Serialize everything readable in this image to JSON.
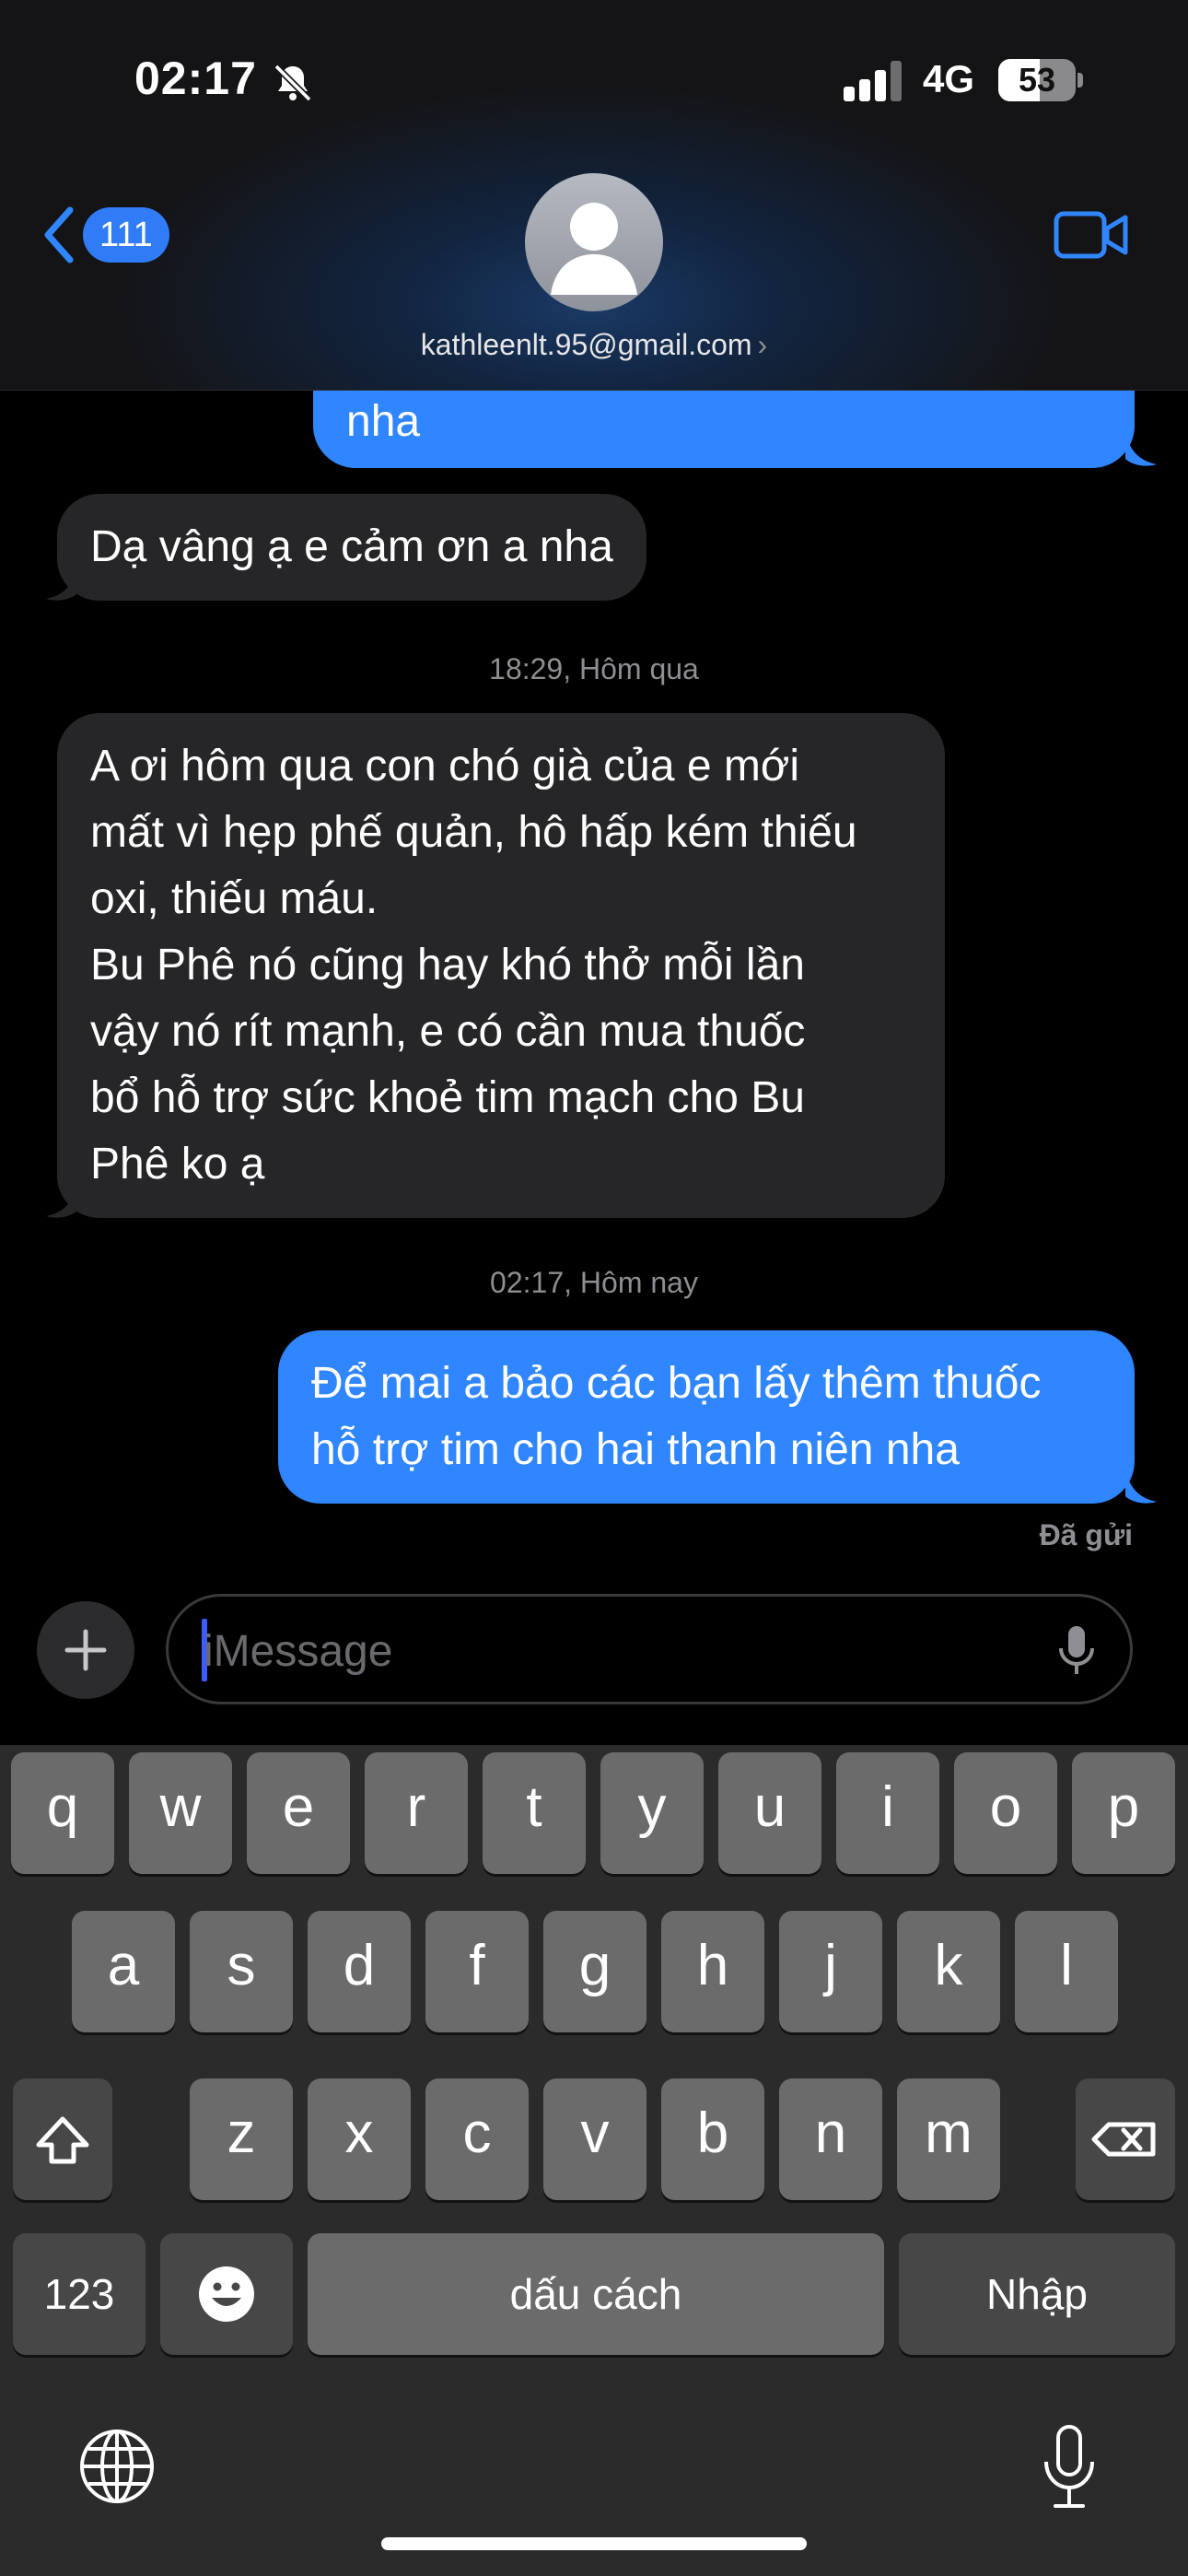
{
  "status": {
    "time": "02:17",
    "network": "4G",
    "battery": "53",
    "battery_level": 0.53
  },
  "header": {
    "back_count": "111",
    "contact": "kathleenlt.95@gmail.com",
    "contact_chevron": "›"
  },
  "messages": [
    {
      "type": "sent",
      "text": "nha"
    },
    {
      "type": "received",
      "text": "Dạ vâng ạ e cảm ơn a nha"
    },
    {
      "type": "timestamp",
      "text": "18:29, Hôm qua"
    },
    {
      "type": "received",
      "lines": [
        "A ơi hôm qua con chó già của e mới",
        "mất vì hẹp phế quản, hô hấp kém thiếu",
        "oxi, thiếu máu.",
        "Bu Phê nó cũng hay khó thở mỗi lần",
        "vậy nó rít mạnh, e có cần mua thuốc",
        "bổ hỗ trợ sức khoẻ tim mạch cho Bu",
        "Phê ko ạ"
      ]
    },
    {
      "type": "timestamp",
      "text": "02:17, Hôm nay"
    },
    {
      "type": "sent",
      "lines": [
        "Để mai a bảo các bạn lấy thêm thuốc",
        "hỗ trợ tim cho hai thanh niên nha"
      ]
    },
    {
      "type": "status",
      "text": "Đã gửi"
    }
  ],
  "input": {
    "placeholder": "iMessage"
  },
  "keyboard": {
    "row1": [
      "q",
      "w",
      "e",
      "r",
      "t",
      "y",
      "u",
      "i",
      "o",
      "p"
    ],
    "row2": [
      "a",
      "s",
      "d",
      "f",
      "g",
      "h",
      "j",
      "k",
      "l"
    ],
    "row3": [
      "z",
      "x",
      "c",
      "v",
      "b",
      "n",
      "m"
    ],
    "numbers_label": "123",
    "space_label": "dấu cách",
    "return_label": "Nhập"
  },
  "icons": [
    "bell-slash-icon",
    "signal-icon",
    "battery-icon",
    "chevron-left-icon",
    "person-icon",
    "video-camera-icon",
    "plus-icon",
    "microphone-icon",
    "shift-icon",
    "delete-icon",
    "emoji-icon",
    "globe-icon",
    "dictation-icon"
  ],
  "colors": {
    "accent": "#2f86ff",
    "received_bubble": "#262629",
    "keyboard_bg": "#2b2b2b",
    "key": "#6b6b6b"
  }
}
